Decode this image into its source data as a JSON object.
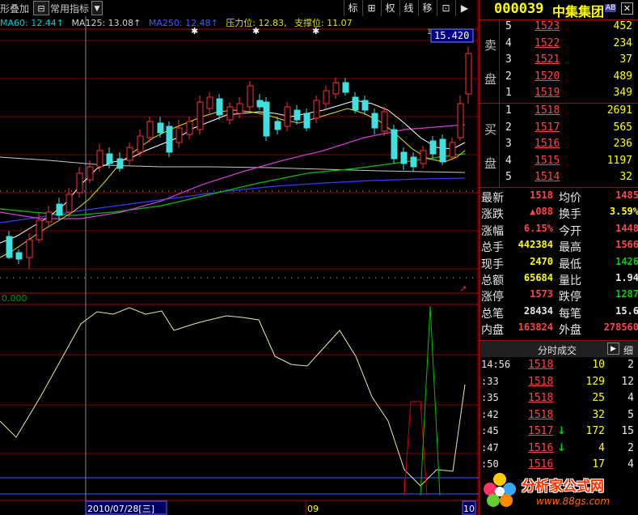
{
  "toolbar": {
    "overlay_label": "形叠加",
    "indicator_label": "常用指标",
    "buttons": [
      "标",
      "⊞",
      "权",
      "线",
      "移",
      "⊡",
      "▶"
    ]
  },
  "ma_line": {
    "ma60": "MA60: 12.44↑",
    "ma125": "MA125: 13.08↑",
    "ma250": "MA250: 12.48↑",
    "pressure": "压力位: 12.83,",
    "support": "支撑位: 11.07"
  },
  "price_tag": "15.420",
  "indicator_zero": "0.000",
  "date_bar": {
    "date": "2010/07/28[三]",
    "month_label": "09",
    "end_label": "10"
  },
  "stock": {
    "code": "000039",
    "name": "中集集团",
    "badge": "AB"
  },
  "sell_side": {
    "label_1": "卖",
    "label_2": "盘",
    "rows": [
      {
        "level": "5",
        "price": "1523",
        "vol": "452"
      },
      {
        "level": "4",
        "price": "1522",
        "vol": "234"
      },
      {
        "level": "3",
        "price": "1521",
        "vol": "37"
      },
      {
        "level": "2",
        "price": "1520",
        "vol": "489"
      },
      {
        "level": "1",
        "price": "1519",
        "vol": "349"
      }
    ]
  },
  "buy_side": {
    "label_1": "买",
    "label_2": "盘",
    "rows": [
      {
        "level": "1",
        "price": "1518",
        "vol": "2691"
      },
      {
        "level": "2",
        "price": "1517",
        "vol": "565"
      },
      {
        "level": "3",
        "price": "1516",
        "vol": "236"
      },
      {
        "level": "4",
        "price": "1515",
        "vol": "1197"
      },
      {
        "level": "5",
        "price": "1514",
        "vol": "32"
      }
    ]
  },
  "stats": [
    {
      "l1": "最新",
      "v1": "1518",
      "l2": "均价",
      "v2": "1485"
    },
    {
      "l1": "涨跌",
      "v1": "▲088",
      "l2": "换手",
      "v2": "3.59%"
    },
    {
      "l1": "涨幅",
      "v1": "6.15%",
      "l2": "今开",
      "v2": "1448"
    },
    {
      "l1": "总手",
      "v1": "442384",
      "l2": "最高",
      "v2": "1566"
    },
    {
      "l1": "现手",
      "v1": "2470",
      "l2": "最低",
      "v2": "1426"
    },
    {
      "l1": "总额",
      "v1": "65684",
      "l2": "量比",
      "v2": "1.94"
    },
    {
      "l1": "涨停",
      "v1": "1573",
      "l2": "跌停",
      "v2": "1287"
    },
    {
      "l1": "总笔",
      "v1": "28434",
      "l2": "每笔",
      "v2": "15.6"
    },
    {
      "l1": "内盘",
      "v1": "163824",
      "l2": "外盘",
      "v2": "278560"
    }
  ],
  "ticks_header": {
    "title": "分时成交",
    "detail": "细"
  },
  "ticks": [
    {
      "time": "14:56",
      "price": "1518",
      "vol": "10",
      "n": "2",
      "arrow": ""
    },
    {
      "time": ":33",
      "price": "1518",
      "vol": "129",
      "n": "12",
      "arrow": ""
    },
    {
      "time": ":35",
      "price": "1518",
      "vol": "25",
      "n": "4",
      "arrow": ""
    },
    {
      "time": ":42",
      "price": "1518",
      "vol": "32",
      "n": "5",
      "arrow": ""
    },
    {
      "time": ":45",
      "price": "1517",
      "vol": "172",
      "n": "15",
      "arrow": "↓"
    },
    {
      "time": ":47",
      "price": "1516",
      "vol": "4",
      "n": "2",
      "arrow": "↓"
    },
    {
      "time": ":50",
      "price": "1516",
      "vol": "17",
      "n": "4",
      "arrow": ""
    }
  ],
  "watermark": {
    "brand": "分析家公式网",
    "url": "www.88gs.com"
  }
}
